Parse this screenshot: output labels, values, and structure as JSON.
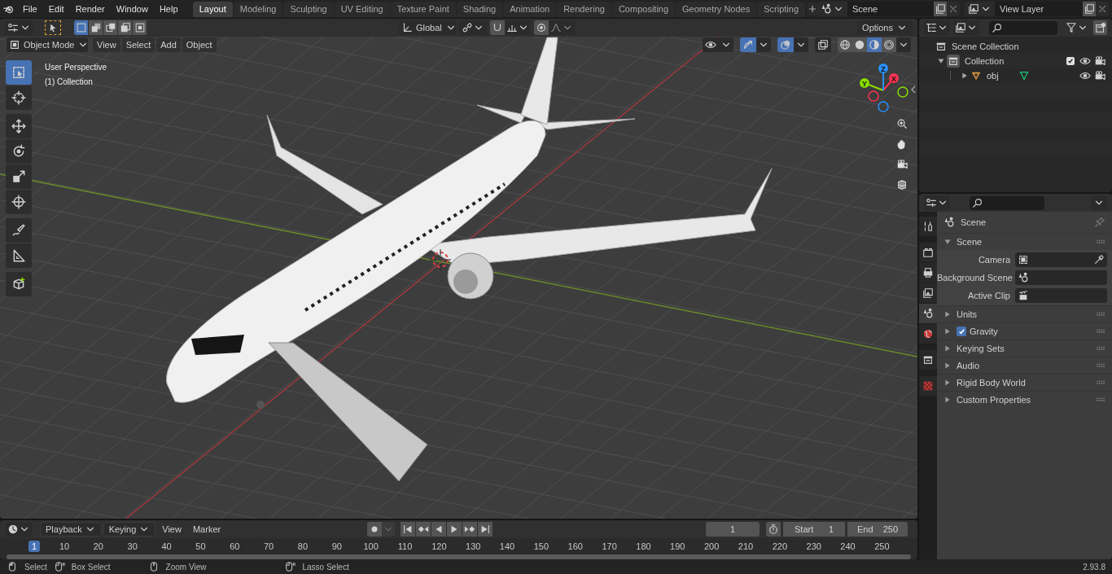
{
  "menu": [
    {
      "label": "File"
    },
    {
      "label": "Edit"
    },
    {
      "label": "Render"
    },
    {
      "label": "Window"
    },
    {
      "label": "Help"
    }
  ],
  "workspaces": [
    {
      "label": "Layout",
      "selected": true
    },
    {
      "label": "Modeling",
      "selected": false
    },
    {
      "label": "Sculpting",
      "selected": false
    },
    {
      "label": "UV Editing",
      "selected": false
    },
    {
      "label": "Texture Paint",
      "selected": false
    },
    {
      "label": "Shading",
      "selected": false
    },
    {
      "label": "Animation",
      "selected": false
    },
    {
      "label": "Rendering",
      "selected": false
    },
    {
      "label": "Compositing",
      "selected": false
    },
    {
      "label": "Geometry Nodes",
      "selected": false
    },
    {
      "label": "Scripting",
      "selected": false
    }
  ],
  "scene": {
    "value": "Scene"
  },
  "view_layer": {
    "value": "View Layer"
  },
  "tool_settings": {
    "select_modes": [
      {
        "selected": true
      },
      {
        "selected": false
      },
      {
        "selected": false
      },
      {
        "selected": false
      },
      {
        "selected": false
      }
    ],
    "orientation": "Global",
    "options": "Options"
  },
  "viewport": {
    "mode": "Object Mode",
    "menus": [
      "View",
      "Select",
      "Add",
      "Object"
    ],
    "toggles": [
      {
        "kind": "visibility",
        "selected": false
      },
      {
        "kind": "gizmo",
        "selected": true
      },
      {
        "kind": "overlay",
        "selected": true
      },
      {
        "kind": "xray",
        "selected": false
      }
    ],
    "shading": [
      {
        "kind": "wireframe",
        "selected": false
      },
      {
        "kind": "solid",
        "selected": false
      },
      {
        "kind": "material",
        "selected": true
      },
      {
        "kind": "rendered",
        "selected": false
      }
    ],
    "overlay_text": [
      "User Perspective",
      "(1) Collection"
    ],
    "tools": [
      {
        "kind": "select",
        "selected": true
      },
      {
        "kind": "cursor",
        "selected": false
      },
      {
        "kind": "move",
        "selected": false
      },
      {
        "kind": "rotate",
        "selected": false
      },
      {
        "kind": "scale",
        "selected": false
      },
      {
        "kind": "transform",
        "selected": false
      },
      {
        "kind": "annotate",
        "selected": false
      },
      {
        "kind": "measure",
        "selected": false
      },
      {
        "kind": "add_cube",
        "selected": false
      }
    ],
    "gizmo_axes": [
      {
        "label": "X",
        "color": "#ff3352"
      },
      {
        "label": "Y",
        "color": "#8bdc00"
      },
      {
        "label": "Z",
        "color": "#2890ff"
      }
    ]
  },
  "outliner": {
    "items": [
      {
        "label": "Scene Collection",
        "children": [
          {
            "label": "Collection",
            "expanded": true,
            "checked": true,
            "children": [
              {
                "label": "obj",
                "expanded": false
              }
            ]
          }
        ]
      }
    ]
  },
  "properties": {
    "tabs": [
      {
        "kind": "tool",
        "selected": false
      },
      {
        "kind": "render",
        "selected": false
      },
      {
        "kind": "output",
        "selected": false
      },
      {
        "kind": "view_layer",
        "selected": false
      },
      {
        "kind": "scene",
        "selected": true
      },
      {
        "kind": "world",
        "selected": false
      },
      {
        "kind": "collection",
        "selected": false
      },
      {
        "kind": "texture",
        "selected": false
      }
    ],
    "context": "Scene",
    "panels": [
      {
        "kind": "panel",
        "label": "Scene",
        "expanded": true,
        "fields": [
          {
            "label": "Camera",
            "kind": "camera"
          },
          {
            "label": "Background Scene",
            "kind": "scene"
          },
          {
            "label": "Active Clip",
            "kind": "clip"
          }
        ]
      },
      {
        "kind": "panel",
        "label": "Units",
        "expanded": false
      },
      {
        "kind": "checkbox_panel",
        "label": "Gravity",
        "expanded": false,
        "checked": true
      },
      {
        "kind": "panel",
        "label": "Keying Sets",
        "expanded": false
      },
      {
        "kind": "panel",
        "label": "Audio",
        "expanded": false
      },
      {
        "kind": "panel",
        "label": "Rigid Body World",
        "expanded": false
      },
      {
        "kind": "panel",
        "label": "Custom Properties",
        "expanded": false
      }
    ]
  },
  "timeline": {
    "menus": [
      {
        "label": "Playback",
        "dropdown": true
      },
      {
        "label": "Keying",
        "dropdown": true
      },
      {
        "label": "View",
        "dropdown": false
      },
      {
        "label": "Marker",
        "dropdown": false
      }
    ],
    "current_frame": "1",
    "start": {
      "label": "Start",
      "value": "1"
    },
    "end": {
      "label": "End",
      "value": "250"
    },
    "ticks": [
      {
        "label": "1",
        "selected": true
      },
      {
        "label": "10",
        "selected": false
      },
      {
        "label": "20",
        "selected": false
      },
      {
        "label": "30",
        "selected": false
      },
      {
        "label": "40",
        "selected": false
      },
      {
        "label": "50",
        "selected": false
      },
      {
        "label": "60",
        "selected": false
      },
      {
        "label": "70",
        "selected": false
      },
      {
        "label": "80",
        "selected": false
      },
      {
        "label": "90",
        "selected": false
      },
      {
        "label": "100",
        "selected": false
      },
      {
        "label": "110",
        "selected": false
      },
      {
        "label": "120",
        "selected": false
      },
      {
        "label": "130",
        "selected": false
      },
      {
        "label": "140",
        "selected": false
      },
      {
        "label": "150",
        "selected": false
      },
      {
        "label": "160",
        "selected": false
      },
      {
        "label": "170",
        "selected": false
      },
      {
        "label": "180",
        "selected": false
      },
      {
        "label": "190",
        "selected": false
      },
      {
        "label": "200",
        "selected": false
      },
      {
        "label": "210",
        "selected": false
      },
      {
        "label": "220",
        "selected": false
      },
      {
        "label": "230",
        "selected": false
      },
      {
        "label": "240",
        "selected": false
      },
      {
        "label": "250",
        "selected": false
      }
    ]
  },
  "status_bar": {
    "items": [
      {
        "kind": "mouse_left",
        "label": "Select"
      },
      {
        "kind": "mouse_drag",
        "label": "Box Select"
      },
      {
        "kind": "mouse_middle",
        "label": "Zoom View"
      },
      {
        "kind": "mouse_drag",
        "label": "Lasso Select"
      }
    ],
    "version": "2.93.8"
  }
}
